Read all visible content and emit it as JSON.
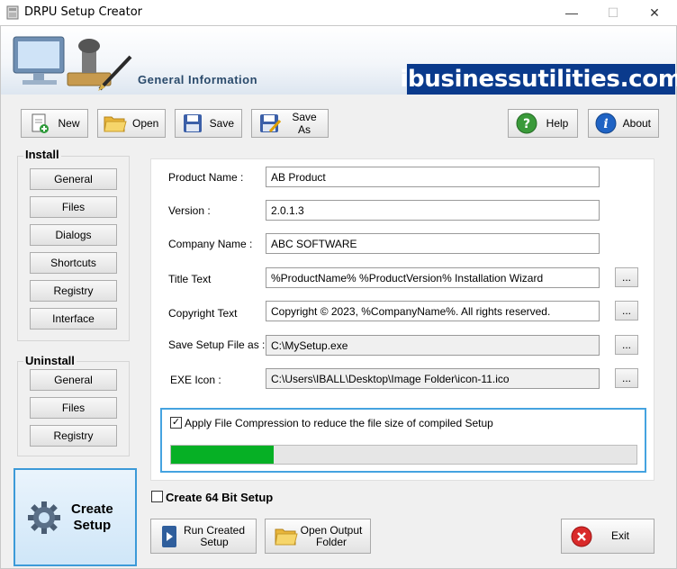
{
  "window": {
    "title": "DRPU Setup Creator",
    "minimize": "—",
    "maximize": "☐",
    "close": "✕"
  },
  "banner": {
    "title": "General Information",
    "brand": "ibusinessutilities.com"
  },
  "toolbar": {
    "new": "New",
    "open": "Open",
    "save": "Save",
    "save_as": "Save As",
    "help": "Help",
    "about": "About"
  },
  "install": {
    "title": "Install",
    "items": [
      "General",
      "Files",
      "Dialogs",
      "Shortcuts",
      "Registry",
      "Interface"
    ]
  },
  "uninstall": {
    "title": "Uninstall",
    "items": [
      "General",
      "Files",
      "Registry"
    ]
  },
  "form": {
    "product_name": {
      "label": "Product Name :",
      "value": "AB Product"
    },
    "version": {
      "label": "Version :",
      "value": "2.0.1.3"
    },
    "company_name": {
      "label": "Company Name :",
      "value": "ABC SOFTWARE"
    },
    "title_text": {
      "label": "Title Text",
      "value": "%ProductName% %ProductVersion% Installation Wizard"
    },
    "copyright_text": {
      "label": "Copyright Text",
      "value": "Copyright © 2023, %CompanyName%. All rights reserved."
    },
    "save_setup_as": {
      "label": "Save Setup File as :",
      "value": "C:\\MySetup.exe"
    },
    "exe_icon": {
      "label": "EXE Icon :",
      "value": "C:\\Users\\IBALL\\Desktop\\Image Folder\\icon-11.ico"
    },
    "browse": "..."
  },
  "compression": {
    "label": "Apply File Compression to reduce the file size of compiled Setup",
    "checked": true,
    "progress": 0.22
  },
  "create64": {
    "label": "Create 64 Bit Setup",
    "checked": false
  },
  "actions": {
    "create_setup_line1": "Create",
    "create_setup_line2": "Setup",
    "run_created_line1": "Run Created",
    "run_created_line2": "Setup",
    "open_output_line1": "Open Output",
    "open_output_line2": "Folder",
    "exit": "Exit"
  },
  "colors": {
    "brand_bg": "#0a3a8c",
    "progress": "#06b025",
    "accent_border": "#45a3e0"
  }
}
